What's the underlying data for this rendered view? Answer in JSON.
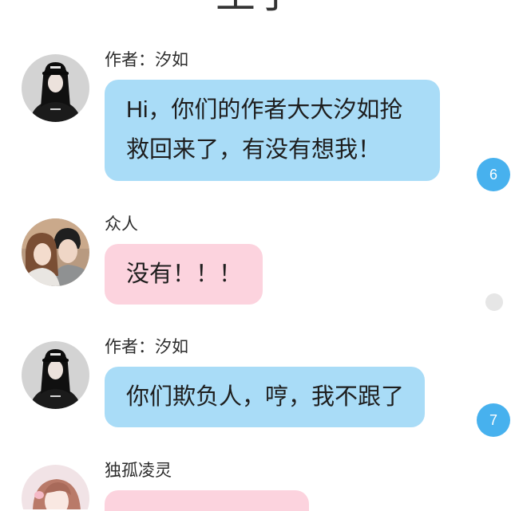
{
  "page": {
    "title": "王子"
  },
  "colors": {
    "background": "#ffffff",
    "bubble_blue": "#a9dcf7",
    "bubble_pink": "#fcd3de",
    "badge_blue": "#47b1ee",
    "indicator_gray": "#e6e6e6"
  },
  "messages": [
    {
      "sender": "作者：汐如",
      "lines": [
        "Hi，你们的作者大大汐如抢",
        "救回来了，有没有想我！"
      ],
      "comment_count": "6"
    },
    {
      "sender": "众人",
      "lines": [
        "没有！！！"
      ]
    },
    {
      "sender": "作者：汐如",
      "lines": [
        "你们欺负人，哼，我不跟了"
      ],
      "comment_count": "7"
    },
    {
      "sender": "独孤凌灵",
      "lines": []
    }
  ]
}
